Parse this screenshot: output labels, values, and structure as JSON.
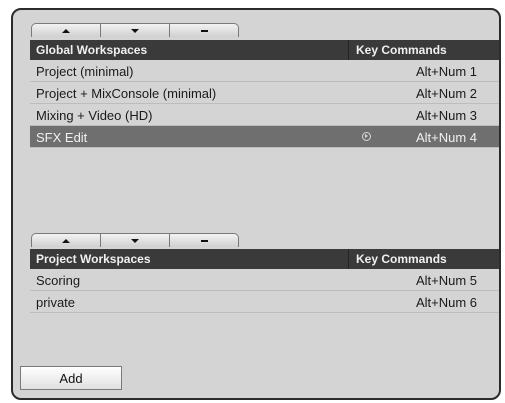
{
  "global": {
    "toolbar": {
      "up_icon": "arrow-up-icon",
      "down_icon": "arrow-down-icon",
      "remove_icon": "minus-icon"
    },
    "header": {
      "name": "Global Workspaces",
      "keys": "Key Commands"
    },
    "rows": [
      {
        "name": "Project (minimal)",
        "key": "Alt+Num 1"
      },
      {
        "name": "Project + MixConsole (minimal)",
        "key": "Alt+Num 2"
      },
      {
        "name": "Mixing + Video (HD)",
        "key": "Alt+Num 3"
      },
      {
        "name": "SFX Edit",
        "key": "Alt+Num 4",
        "selected": true
      }
    ]
  },
  "project": {
    "toolbar": {
      "up_icon": "arrow-up-icon",
      "down_icon": "arrow-down-icon",
      "remove_icon": "minus-icon"
    },
    "header": {
      "name": "Project Workspaces",
      "keys": "Key Commands"
    },
    "rows": [
      {
        "name": "Scoring",
        "key": "Alt+Num 5"
      },
      {
        "name": "private",
        "key": "Alt+Num 6"
      }
    ]
  },
  "add_label": "Add",
  "colors": {
    "panel": "#d4d4d4",
    "header": "#3a3a3a",
    "selected_row": "#6f6f6f"
  }
}
